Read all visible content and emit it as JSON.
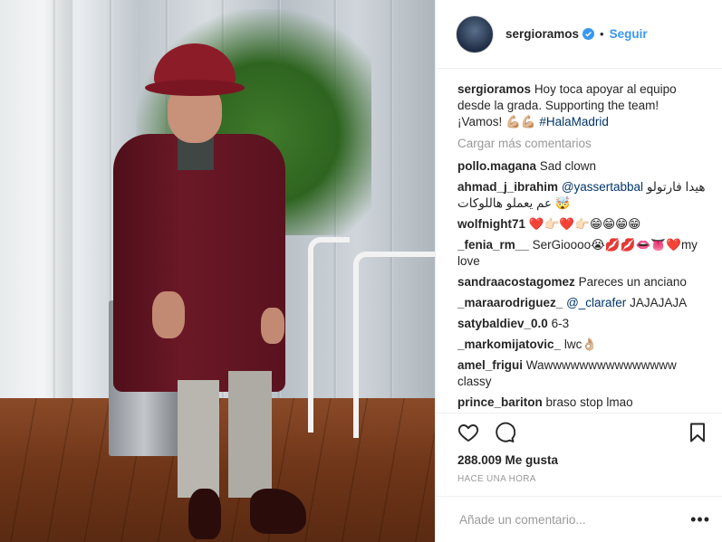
{
  "post": {
    "username": "sergioramos",
    "follow_label": "Seguir",
    "separator": "•",
    "caption_user": "sergioramos",
    "caption_text": "Hoy toca apoyar al equipo desde la grada. Supporting the team! ¡Vamos! 💪🏼💪🏼 ",
    "caption_tag": "#HalaMadrid",
    "load_more": "Cargar más comentarios",
    "likes": "288.009 Me gusta",
    "timestamp": "HACE UNA HORA",
    "add_comment_placeholder": "Añade un comentario...",
    "options_label": "•••"
  },
  "comments": [
    {
      "user": "pollo.magana",
      "text": "Sad clown"
    },
    {
      "user": "ahmad_j_ibrahim",
      "mention": "@yassertabbal",
      "text": " هيدا فارتولو عم يعملو هاللوكات 🤯"
    },
    {
      "user": "wolfnight71",
      "text": "❤️👉🏻❤️👉🏻😁😁😁😁"
    },
    {
      "user": "_fenia_rm__",
      "text": "SerGioooo😭💋💋👄👅❤️my love"
    },
    {
      "user": "sandraacostagomez",
      "text": "Pareces un anciano"
    },
    {
      "user": "_maraarodriguez_",
      "mention": "@_clarafer",
      "text": " JAJAJAJA"
    },
    {
      "user": "satybaldiev_0.0",
      "text": "6-3"
    },
    {
      "user": "_markomijatovic_",
      "text": "lwc👌🏼"
    },
    {
      "user": "amel_frigui",
      "text": "Wawwwwwwwwwwwwwww classy"
    },
    {
      "user": "prince_bariton",
      "text": "braso stop lmao"
    }
  ],
  "icons": [
    "verified-icon",
    "heart-icon",
    "comment-icon",
    "bookmark-icon"
  ],
  "colors": {
    "link": "#3897f0",
    "hashtag": "#003569",
    "muted": "#999999",
    "border": "#efefef",
    "text": "#262626"
  }
}
